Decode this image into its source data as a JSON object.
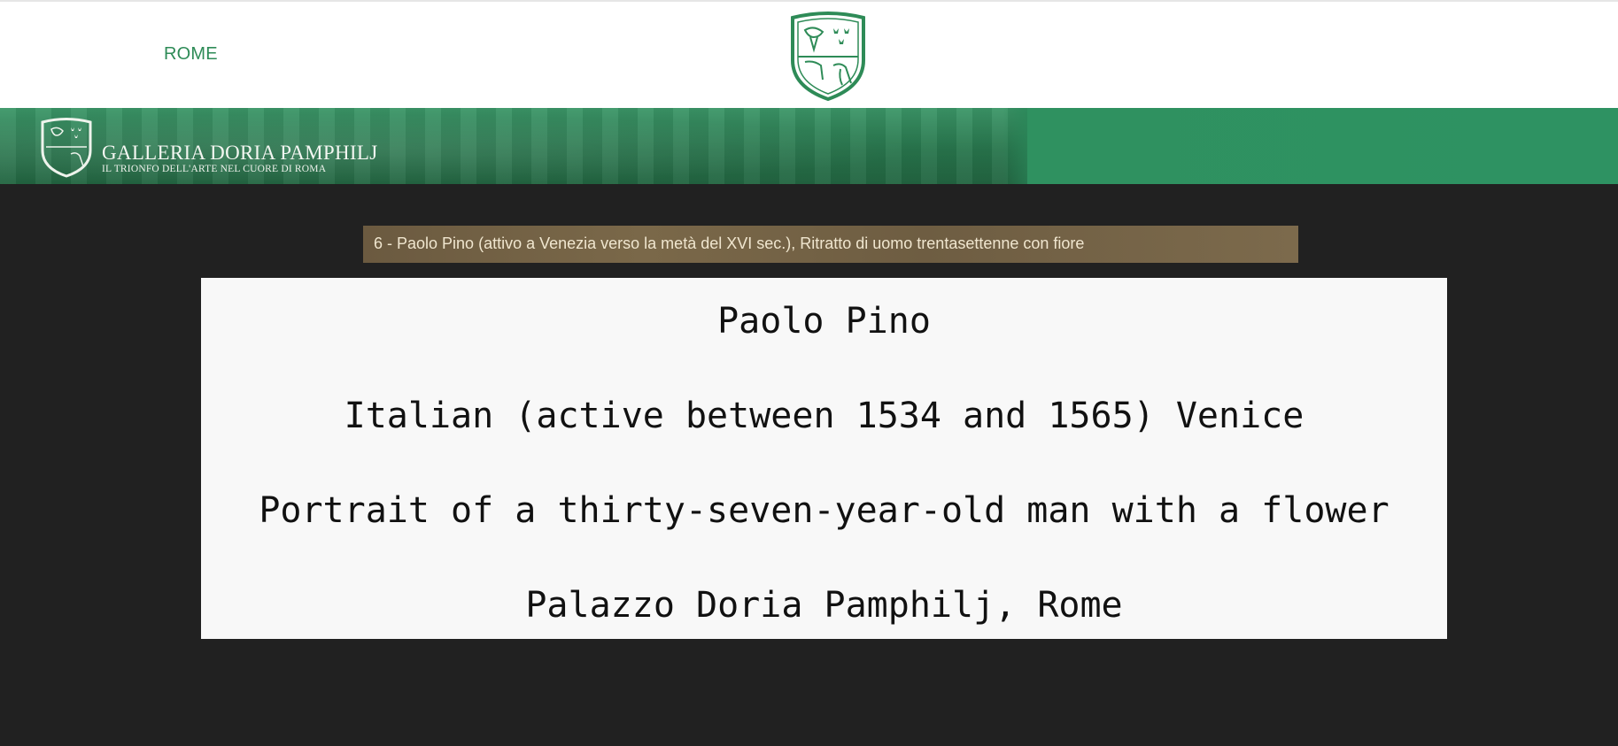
{
  "header": {
    "nav": {
      "rome_label": "ROME"
    },
    "brand_color": "#2e8b57"
  },
  "banner": {
    "title": "GALLERIA DORIA PAMPHILJ",
    "subtitle": "IL TRIONFO DELL'ARTE NEL CUORE DI ROMA"
  },
  "caption": {
    "text": "6   - Paolo Pino (attivo a Venezia verso la metà del XVI sec.), Ritratto di uomo trentasettenne con fiore"
  },
  "artwork": {
    "artist": "Paolo Pino",
    "nationality": "Italian (active between 1534 and 1565) Venice",
    "title": "Portrait of a thirty-seven-year-old man with a flower",
    "location": "Palazzo Doria Pamphilj, Rome"
  }
}
